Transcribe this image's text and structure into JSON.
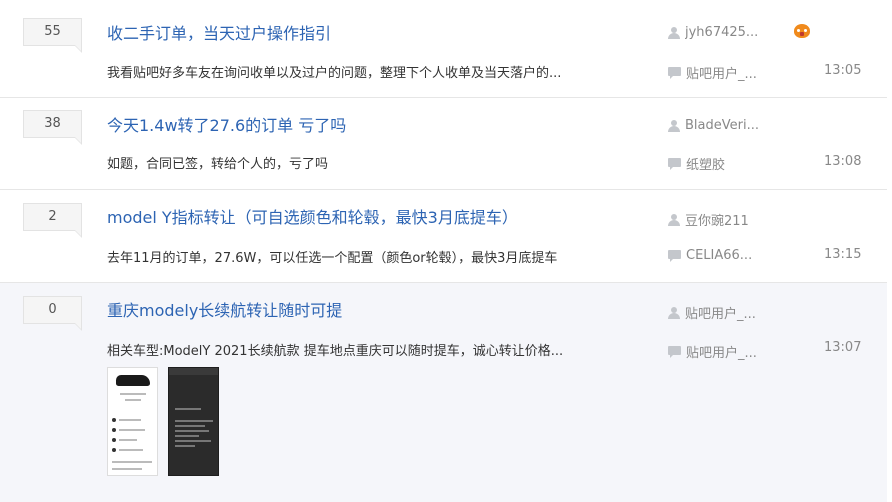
{
  "threads": [
    {
      "reply_count": "55",
      "title": "收二手订单，当天过户操作指引",
      "abstract": "我看贴吧好多车友在询问收单以及过户的问题，整理下个人收单及当天落户的...",
      "author": "jyh67425...",
      "last_replier": "贴吧用户_...",
      "time": "13:05",
      "author_badge_icon": "game-controller-badge-icon"
    },
    {
      "reply_count": "38",
      "title": "今天1.4w转了27.6的订单 亏了吗",
      "abstract": "如题，合同已签，转给个人的，亏了吗",
      "author": "BladeVeri...",
      "last_replier": "纸塑胶",
      "time": "13:08"
    },
    {
      "reply_count": "2",
      "title": "model Y指标转让（可自选颜色和轮毂，最快3月底提车）",
      "abstract": "去年11月的订单，27.6W，可以任选一个配置（颜色or轮毂），最快3月底提车",
      "author": "豆你豌211",
      "last_replier": "CELIA66...",
      "time": "13:15"
    },
    {
      "reply_count": "0",
      "title": "重庆modely长续航转让随时可提",
      "abstract": "相关车型:ModelY 2021长续航款 提车地点重庆可以随时提车，诚心转让价格...",
      "author": "贴吧用户_...",
      "last_replier": "贴吧用户_...",
      "time": "13:07",
      "thumbnails": [
        "order-screenshot-light",
        "order-screenshot-dark"
      ]
    }
  ],
  "icons": {
    "author": "user-icon",
    "last_reply": "reply-bubble-icon"
  },
  "colors": {
    "title_link": "#2d64b3",
    "highlight_row": "#f5f6fa",
    "badge_orange": "#f08a1c"
  }
}
